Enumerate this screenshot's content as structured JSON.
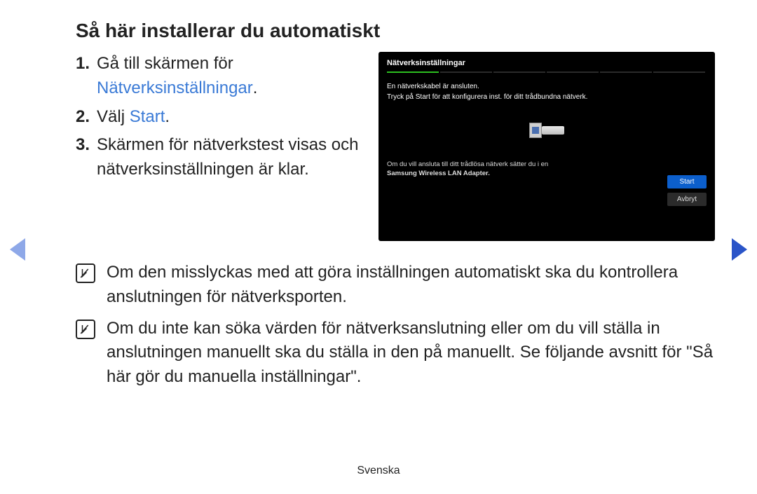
{
  "title": "Så här installerar du automatiskt",
  "steps": [
    {
      "num": "1.",
      "prefix": "Gå till skärmen för ",
      "link": "Nätverksinställningar",
      "suffix": "."
    },
    {
      "num": "2.",
      "prefix": "Välj ",
      "link": "Start",
      "suffix": "."
    },
    {
      "num": "3.",
      "prefix": "Skärmen för nätverkstest visas och nätverksinställningen är klar.",
      "link": "",
      "suffix": ""
    }
  ],
  "tv": {
    "title": "Nätverksinställningar",
    "status": "En nätverkskabel är ansluten.",
    "instruction": "Tryck på Start för att konfigurera inst. för ditt trådbundna nätverk.",
    "footer_line1": "Om du vill ansluta till ditt trådlösa nätverk sätter du i en",
    "footer_line2": "Samsung Wireless LAN Adapter.",
    "btn_primary": "Start",
    "btn_secondary": "Avbryt"
  },
  "notes": [
    "Om den misslyckas med att göra inställningen automatiskt ska du kontrollera anslutningen för nätverksporten.",
    "Om du inte kan söka värden för nätverksanslutning eller om du vill ställa in anslutningen manuellt ska du ställa in den på manuellt. Se följande avsnitt för \"Så här gör du manuella inställningar\"."
  ],
  "language": "Svenska"
}
